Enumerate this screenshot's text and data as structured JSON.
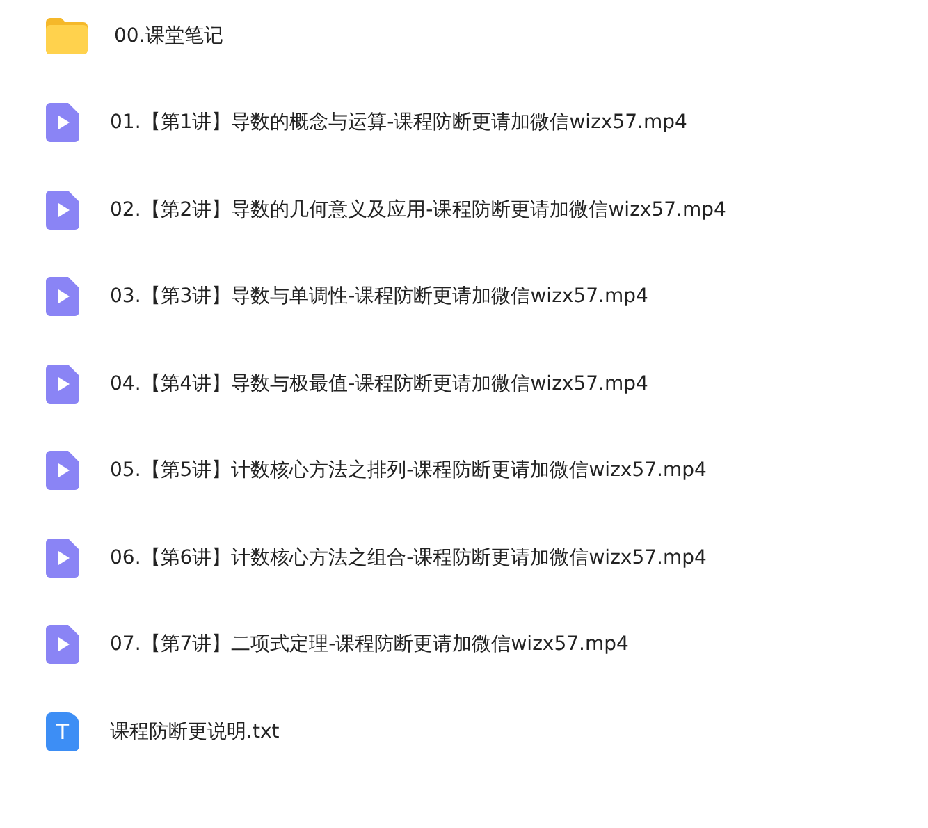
{
  "files": [
    {
      "kind": "folder",
      "name": "00.课堂笔记"
    },
    {
      "kind": "video",
      "name": "01.【第1讲】导数的概念与运算-课程防断更请加微信wizx57.mp4"
    },
    {
      "kind": "video",
      "name": "02.【第2讲】导数的几何意义及应用-课程防断更请加微信wizx57.mp4"
    },
    {
      "kind": "video",
      "name": "03.【第3讲】导数与单调性-课程防断更请加微信wizx57.mp4"
    },
    {
      "kind": "video",
      "name": "04.【第4讲】导数与极最值-课程防断更请加微信wizx57.mp4"
    },
    {
      "kind": "video",
      "name": "05.【第5讲】计数核心方法之排列-课程防断更请加微信wizx57.mp4"
    },
    {
      "kind": "video",
      "name": "06.【第6讲】计数核心方法之组合-课程防断更请加微信wizx57.mp4"
    },
    {
      "kind": "video",
      "name": "07.【第7讲】二项式定理-课程防断更请加微信wizx57.mp4"
    },
    {
      "kind": "text",
      "name": "课程防断更说明.txt",
      "icon_letter": "T"
    }
  ]
}
